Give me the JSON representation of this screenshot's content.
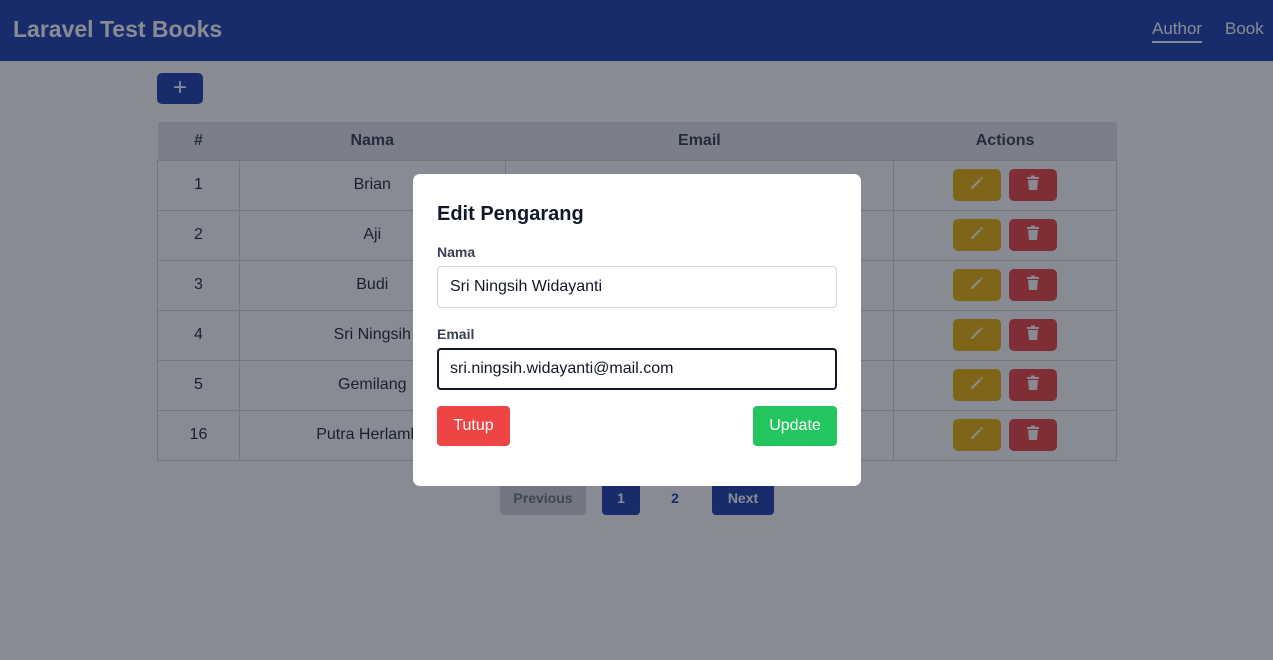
{
  "navbar": {
    "brand": "Laravel Test Books",
    "links": [
      {
        "label": "Author"
      },
      {
        "label": "Book"
      }
    ]
  },
  "toolbar": {
    "add_icon": "plus-icon",
    "add_label": "+"
  },
  "table": {
    "headers": [
      "#",
      "Nama",
      "Email",
      "Actions"
    ],
    "rows": [
      {
        "num": "1",
        "nama": "Brian"
      },
      {
        "num": "2",
        "nama": "Aji"
      },
      {
        "num": "3",
        "nama": "Budi"
      },
      {
        "num": "4",
        "nama": "Sri Ningsih"
      },
      {
        "num": "5",
        "nama": "Gemilang"
      },
      {
        "num": "16",
        "nama": "Putra Herlamba"
      }
    ],
    "action_icons": [
      "pencil-icon",
      "trash-icon"
    ]
  },
  "pagination": {
    "previous": "Previous",
    "pages": [
      "1",
      "2"
    ],
    "current_page": "1",
    "next": "Next"
  },
  "modal": {
    "title": "Edit Pengarang",
    "nama_label": "Nama",
    "nama_value": "Sri Ningsih Widayanti",
    "email_label": "Email",
    "email_value": "sri.ningsih.widayanti@mail.com",
    "close_label": "Tutup",
    "update_label": "Update"
  },
  "colors": {
    "primary": "#1e40af",
    "edit": "#eab308",
    "delete": "#ef4444",
    "update": "#22c55e"
  }
}
